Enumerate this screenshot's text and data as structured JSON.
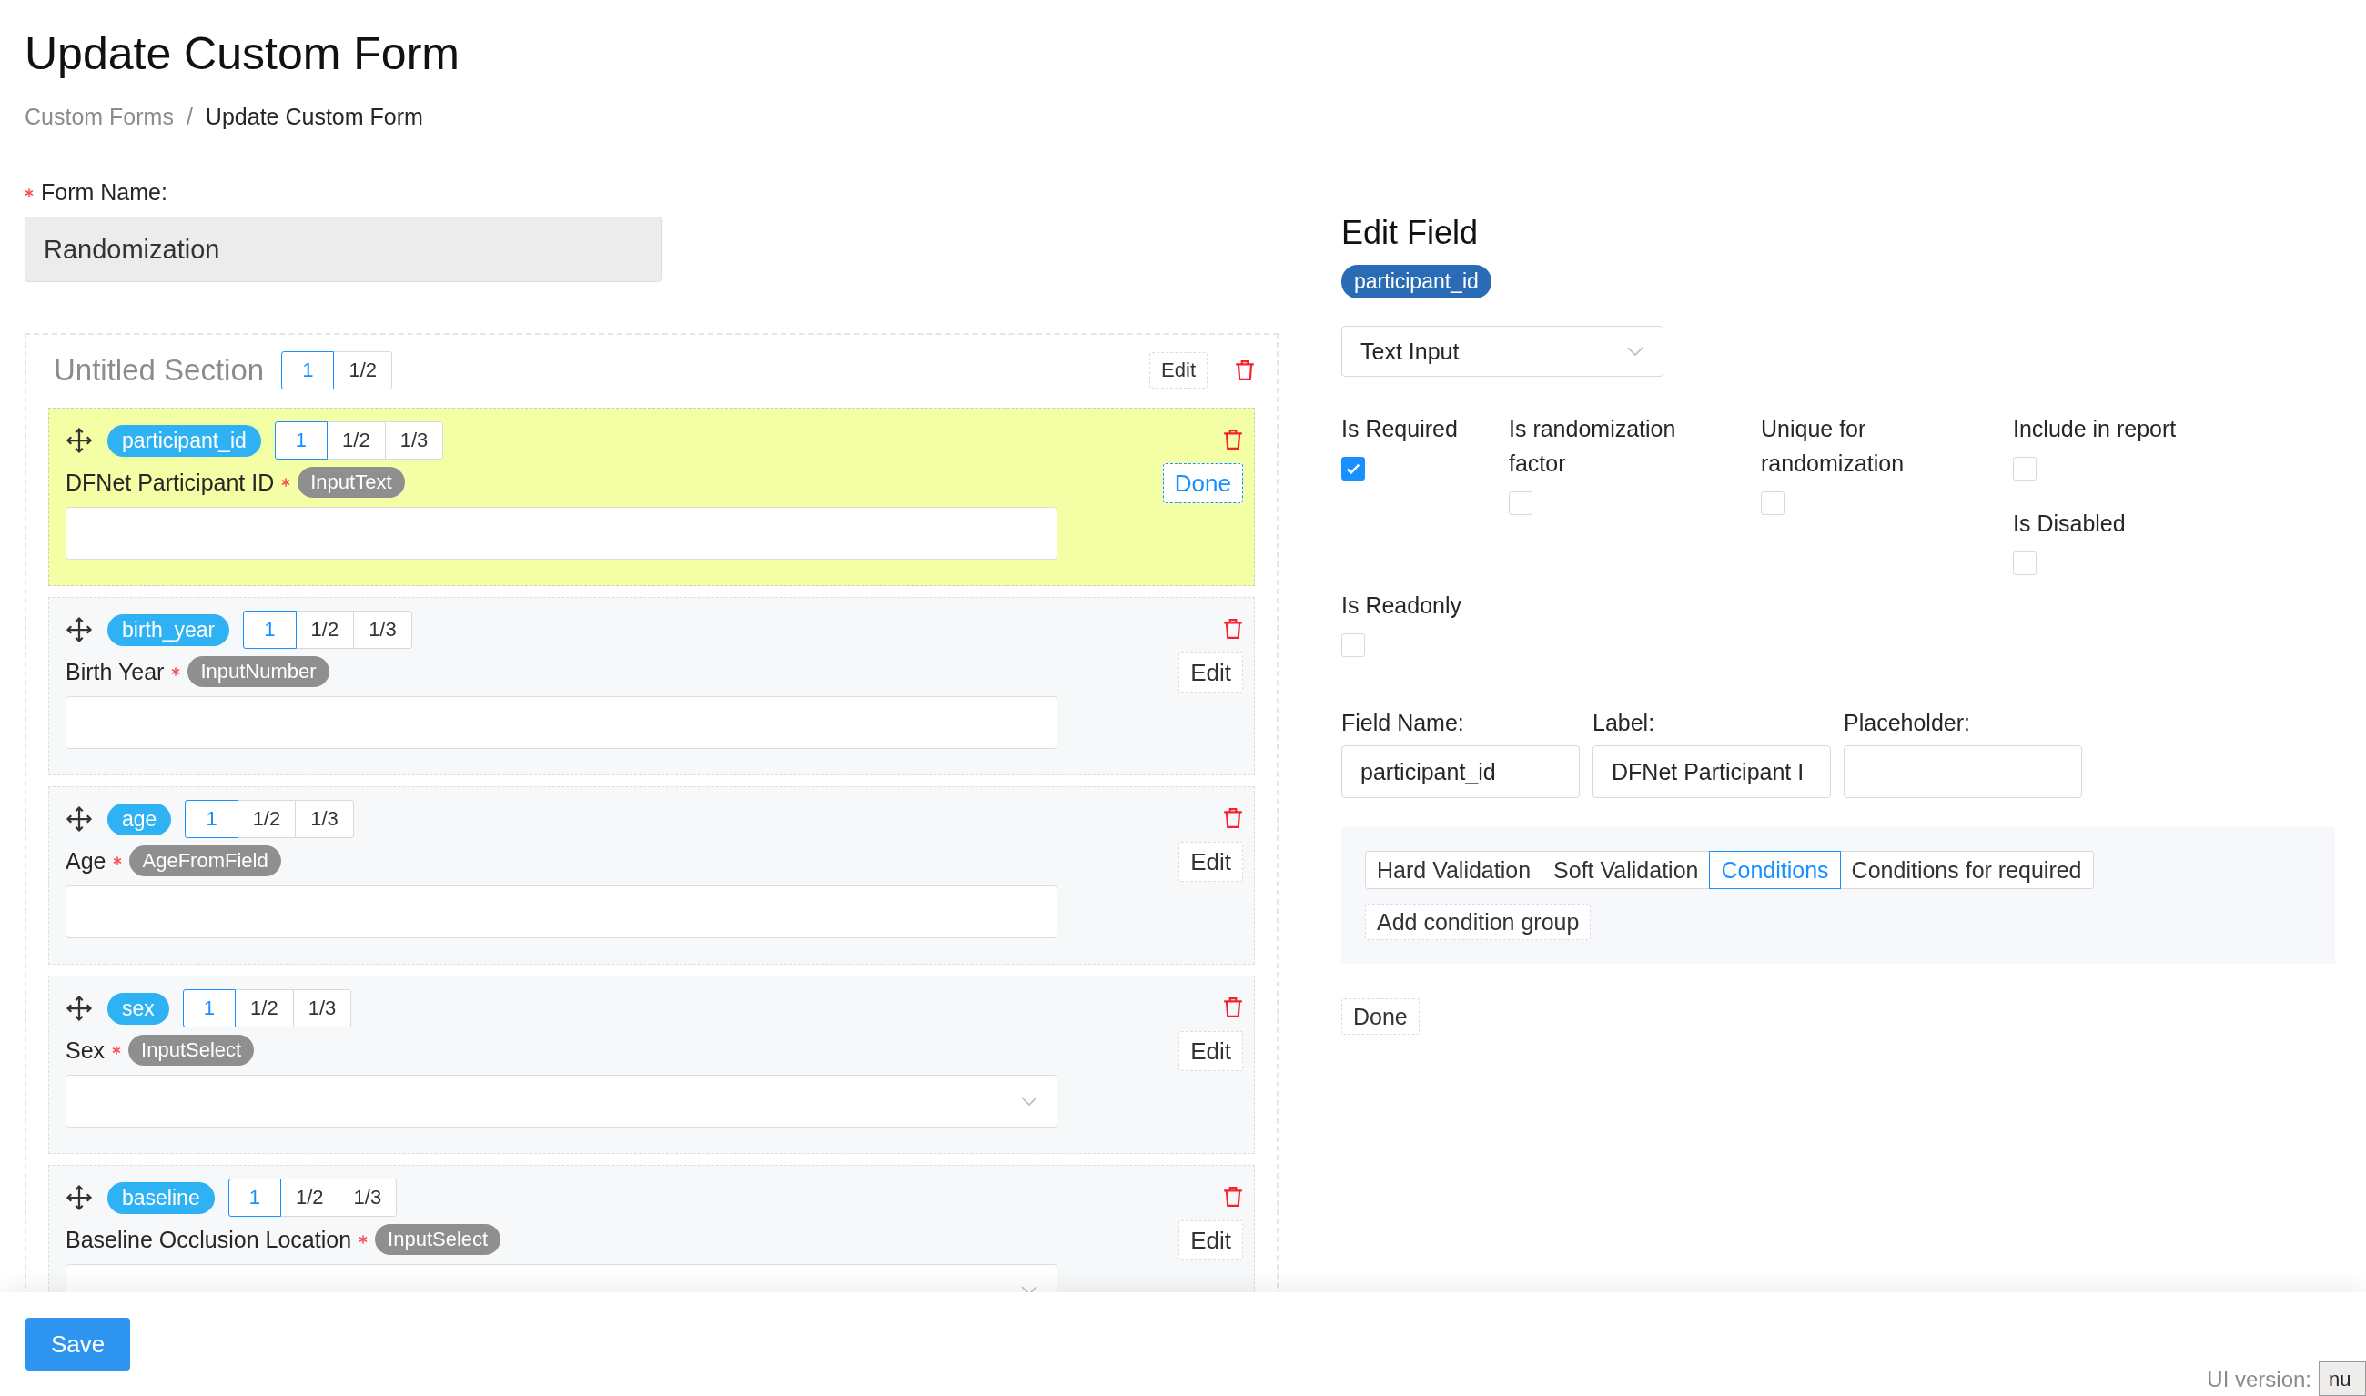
{
  "page": {
    "title": "Update Custom Form"
  },
  "breadcrumb": {
    "separator": "/",
    "items": [
      {
        "label": "Custom Forms",
        "current": false
      },
      {
        "label": "Update Custom Form",
        "current": true
      }
    ]
  },
  "form_name": {
    "label": "Form Name:",
    "required": true,
    "value": "Randomization"
  },
  "section": {
    "title": "Untitled Section",
    "edit_label": "Edit",
    "widths": [
      {
        "label": "1",
        "selected": true
      },
      {
        "label": "1/2",
        "selected": false
      }
    ]
  },
  "fields": [
    {
      "name": "participant_id",
      "label": "DFNet Participant ID",
      "required": true,
      "type": "InputText",
      "kind": "text",
      "editing": true,
      "action": "Done",
      "widths": [
        {
          "label": "1",
          "selected": true
        },
        {
          "label": "1/2",
          "selected": false
        },
        {
          "label": "1/3",
          "selected": false
        }
      ]
    },
    {
      "name": "birth_year",
      "label": "Birth Year",
      "required": true,
      "type": "InputNumber",
      "kind": "text",
      "editing": false,
      "action": "Edit",
      "widths": [
        {
          "label": "1",
          "selected": true
        },
        {
          "label": "1/2",
          "selected": false
        },
        {
          "label": "1/3",
          "selected": false
        }
      ]
    },
    {
      "name": "age",
      "label": "Age",
      "required": true,
      "type": "AgeFromField",
      "kind": "text",
      "editing": false,
      "action": "Edit",
      "widths": [
        {
          "label": "1",
          "selected": true
        },
        {
          "label": "1/2",
          "selected": false
        },
        {
          "label": "1/3",
          "selected": false
        }
      ]
    },
    {
      "name": "sex",
      "label": "Sex",
      "required": true,
      "type": "InputSelect",
      "kind": "select",
      "editing": false,
      "action": "Edit",
      "widths": [
        {
          "label": "1",
          "selected": true
        },
        {
          "label": "1/2",
          "selected": false
        },
        {
          "label": "1/3",
          "selected": false
        }
      ]
    },
    {
      "name": "baseline",
      "label": "Baseline Occlusion Location",
      "required": true,
      "type": "InputSelect",
      "kind": "select",
      "editing": false,
      "action": "Edit",
      "widths": [
        {
          "label": "1",
          "selected": true
        },
        {
          "label": "1/2",
          "selected": false
        },
        {
          "label": "1/3",
          "selected": false
        }
      ]
    }
  ],
  "edit_field": {
    "title": "Edit Field",
    "name_tag": "participant_id",
    "type_select": "Text Input",
    "options": [
      {
        "label": "Is Required",
        "checked": true
      },
      {
        "label": "Is randomization factor",
        "checked": false
      },
      {
        "label": "Unique for randomization",
        "checked": false
      },
      {
        "label": "Include in report",
        "checked": false
      },
      {
        "label": "Is Disabled",
        "checked": false
      },
      {
        "label": "Is Readonly",
        "checked": false
      }
    ],
    "inputs": [
      {
        "label": "Field Name:",
        "value": "participant_id"
      },
      {
        "label": "Label:",
        "value": "DFNet Participant I"
      },
      {
        "label": "Placeholder:"
      }
    ],
    "tabs": [
      {
        "label": "Hard Validation",
        "selected": false
      },
      {
        "label": "Soft Validation",
        "selected": false
      },
      {
        "label": "Conditions",
        "selected": true
      },
      {
        "label": "Conditions for required",
        "selected": false
      }
    ],
    "add_group_button": "Add condition group",
    "done_button": "Done"
  },
  "footer": {
    "save_button": "Save",
    "version_label": "UI version:",
    "version_value": "nu"
  }
}
